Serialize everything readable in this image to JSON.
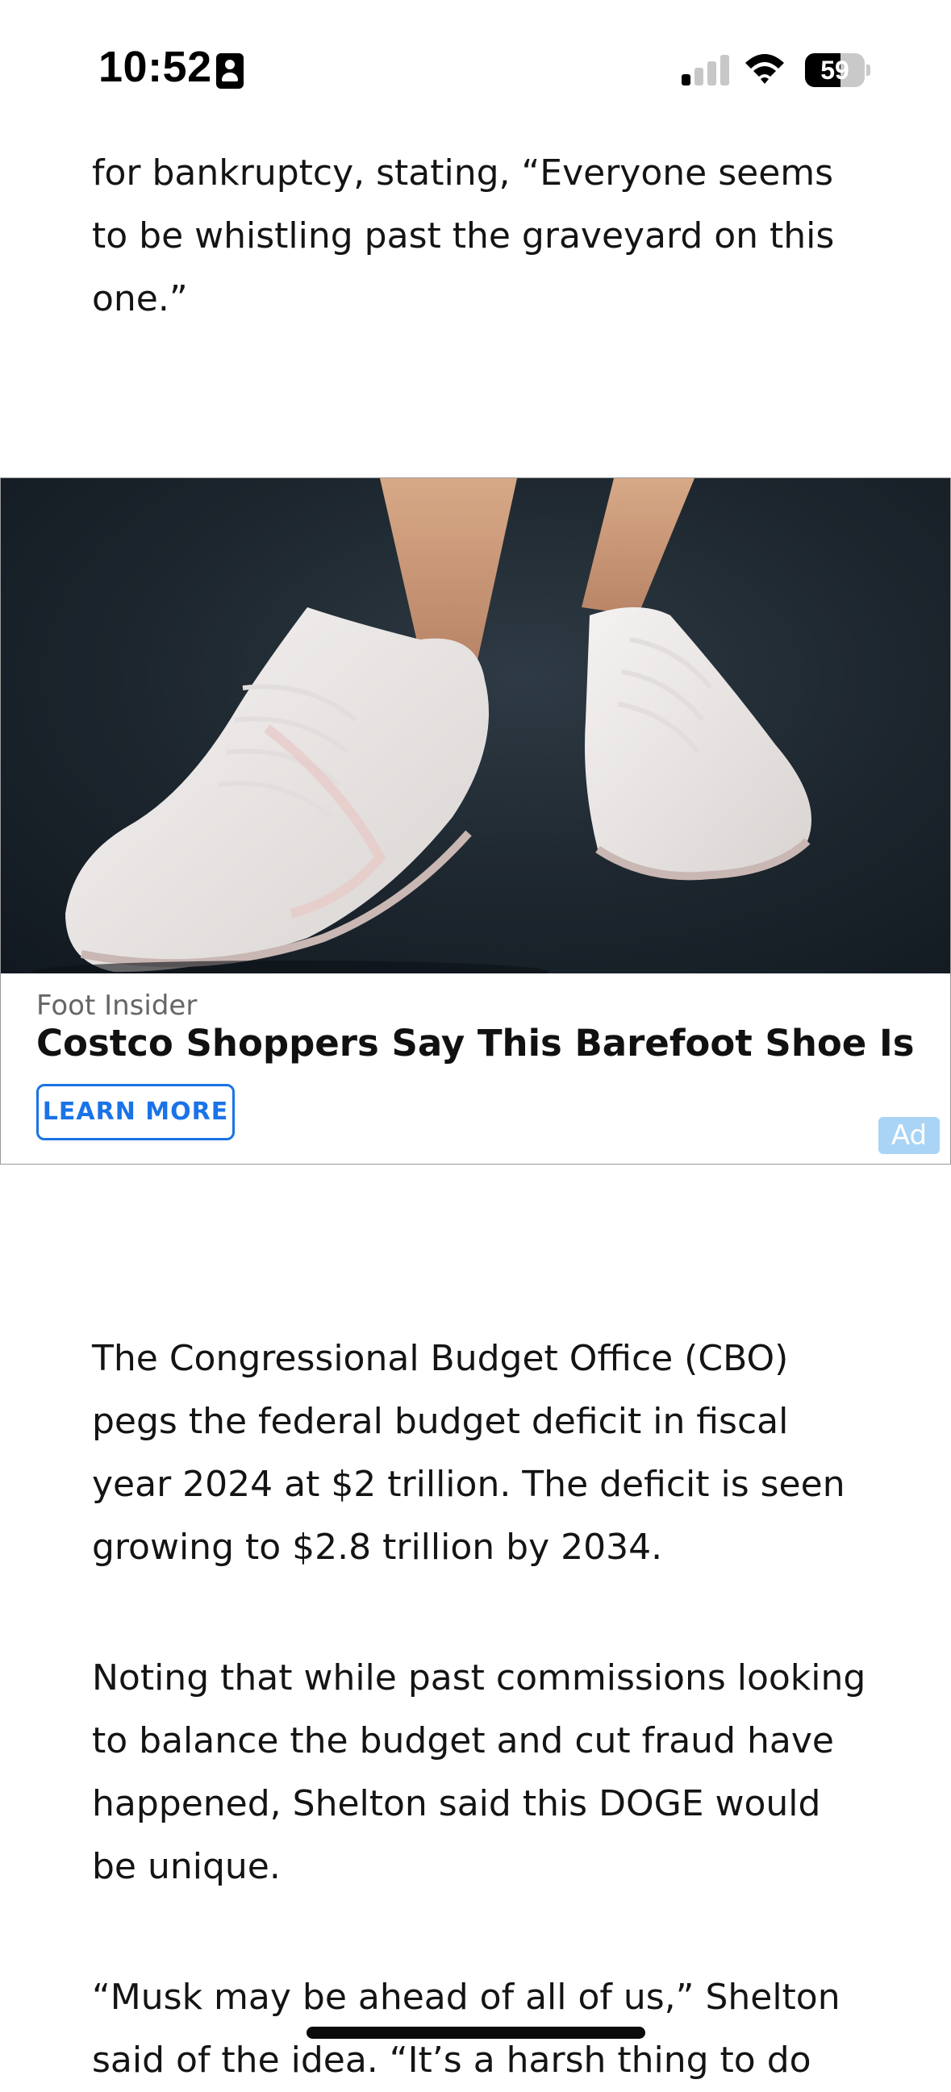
{
  "status_bar": {
    "time": "10:52",
    "battery_level": "59",
    "icons": [
      "id-card-icon",
      "cellular-signal-icon",
      "wifi-icon",
      "battery-icon"
    ],
    "signal_bars_active": 1,
    "signal_bars_total": 4
  },
  "article": {
    "paragraphs": [
      "for bankruptcy, stating, “Everyone seems to be whistling past the graveyard on this one.”",
      "The Congressional Budget Office (CBO) pegs the federal budget deficit in fiscal year 2024 at $2 trillion. The deficit is seen growing to $2.8 trillion by 2034.",
      "Noting that while past commissions looking to balance the budget and cut fraud have happened, Shelton said this DOGE would be unique.",
      "“Musk may be ahead of all of us,” Shelton said of the idea. “It’s a harsh thing to do"
    ]
  },
  "ad": {
    "source": "Foot Insider",
    "headline": "Costco Shoppers Say This Barefoot Shoe Is The...",
    "cta_label": "LEARN MORE",
    "badge": "Ad",
    "image_subject": "white-barefoot-shoes-photo",
    "colors": {
      "cta": "#1a73e8",
      "badge_bg": "#a9d4f5"
    }
  }
}
